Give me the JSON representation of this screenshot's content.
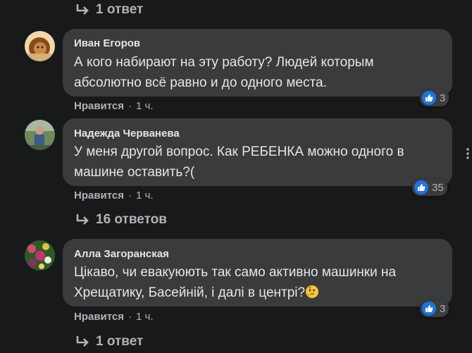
{
  "replies_top": {
    "label": "1 ответ"
  },
  "comments": [
    {
      "author": "Иван Егоров",
      "lines": [
        "А кого набирают на эту работу? Людей которым",
        "абсолютно всё равно и до одного места."
      ],
      "like_label": "Нравится",
      "separator": "·",
      "time": "1 ч.",
      "reactions": "3",
      "avatar_icon": "lion-avatar"
    },
    {
      "author": "Надежда Черванева",
      "lines": [
        "У меня другой вопрос. Как РЕБЕНКА можно одного в",
        "машине оставить?("
      ],
      "like_label": "Нравится",
      "separator": "·",
      "time": "1 ч.",
      "reactions": "35",
      "avatar_icon": "person-photo-avatar",
      "replies_label": "16 ответов"
    },
    {
      "author": "Алла Загоранская",
      "lines": [
        "Цікаво, чи евакуюють так само активно машинки на",
        "Хрещатику, Басейній, і далі в центрі?"
      ],
      "like_label": "Нравится",
      "separator": "·",
      "time": "1 ч.",
      "reactions": "3",
      "avatar_icon": "flowers-avatar",
      "emoji_icon": "thinking-face-icon",
      "replies_label": "1 ответ"
    }
  ],
  "colors": {
    "background": "#18191a",
    "bubble": "#3a3b3c",
    "text": "#e4e6eb",
    "muted": "#b0b3b8",
    "like_blue": "#1b74e4"
  }
}
